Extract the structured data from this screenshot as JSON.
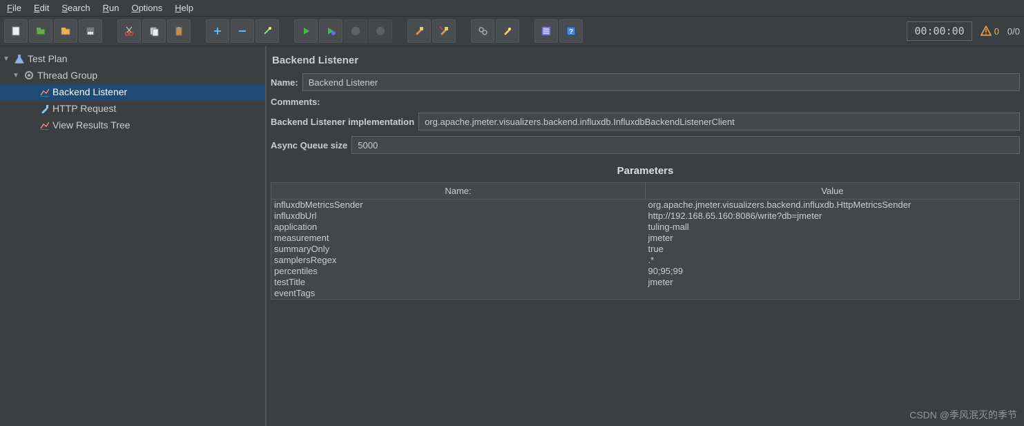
{
  "menu": {
    "items": [
      "File",
      "Edit",
      "Search",
      "Run",
      "Options",
      "Help"
    ]
  },
  "toolbar": {
    "buttons": [
      {
        "name": "new-icon",
        "title": "New"
      },
      {
        "name": "open-template-icon",
        "title": "Templates"
      },
      {
        "name": "open-icon",
        "title": "Open"
      },
      {
        "name": "save-icon",
        "title": "Save"
      },
      {
        "gap": true
      },
      {
        "name": "cut-icon",
        "title": "Cut"
      },
      {
        "name": "copy-icon",
        "title": "Copy"
      },
      {
        "name": "paste-icon",
        "title": "Paste"
      },
      {
        "gap": true
      },
      {
        "name": "plus-icon",
        "title": "Add"
      },
      {
        "name": "minus-icon",
        "title": "Remove"
      },
      {
        "name": "wand-icon",
        "title": "Toggle"
      },
      {
        "gap": true
      },
      {
        "name": "play-icon",
        "title": "Start"
      },
      {
        "name": "play-no-timer-icon",
        "title": "Start no pauses"
      },
      {
        "name": "stop-icon",
        "title": "Stop",
        "disabled": true
      },
      {
        "name": "shutdown-icon",
        "title": "Shutdown",
        "disabled": true
      },
      {
        "gap": true
      },
      {
        "name": "clear-icon",
        "title": "Clear"
      },
      {
        "name": "clear-all-icon",
        "title": "Clear All"
      },
      {
        "gap": true
      },
      {
        "name": "search-tree-icon",
        "title": "Search"
      },
      {
        "name": "reset-search-icon",
        "title": "Reset Search"
      },
      {
        "gap": true
      },
      {
        "name": "function-helper-icon",
        "title": "Function Helper"
      },
      {
        "name": "help-icon",
        "title": "Help"
      }
    ],
    "timer": "00:00:00",
    "warn_count": "0",
    "threads": "0/0"
  },
  "tree": {
    "root": {
      "label": "Test Plan",
      "icon": "flask"
    },
    "group": {
      "label": "Thread Group",
      "icon": "gear"
    },
    "children": [
      {
        "label": "Backend Listener",
        "icon": "chart",
        "selected": true
      },
      {
        "label": "HTTP Request",
        "icon": "pipette"
      },
      {
        "label": "View Results Tree",
        "icon": "chart"
      }
    ]
  },
  "editor": {
    "title": "Backend Listener",
    "name_label": "Name:",
    "name_value": "Backend Listener",
    "comments_label": "Comments:",
    "impl_label": "Backend Listener implementation",
    "impl_value": "org.apache.jmeter.visualizers.backend.influxdb.InfluxdbBackendListenerClient",
    "queue_label": "Async Queue size",
    "queue_value": "5000",
    "params_title": "Parameters",
    "params_headers": {
      "name": "Name:",
      "value": "Value"
    },
    "params": [
      {
        "name": "influxdbMetricsSender",
        "value": "org.apache.jmeter.visualizers.backend.influxdb.HttpMetricsSender"
      },
      {
        "name": "influxdbUrl",
        "value": "http://192.168.65.160:8086/write?db=jmeter"
      },
      {
        "name": "application",
        "value": "tuling-mall"
      },
      {
        "name": "measurement",
        "value": "jmeter"
      },
      {
        "name": "summaryOnly",
        "value": "true"
      },
      {
        "name": "samplersRegex",
        "value": ".*"
      },
      {
        "name": "percentiles",
        "value": "90;95;99"
      },
      {
        "name": "testTitle",
        "value": "jmeter"
      },
      {
        "name": "eventTags",
        "value": ""
      }
    ]
  },
  "watermark": "CSDN @季风泯灭的季节"
}
